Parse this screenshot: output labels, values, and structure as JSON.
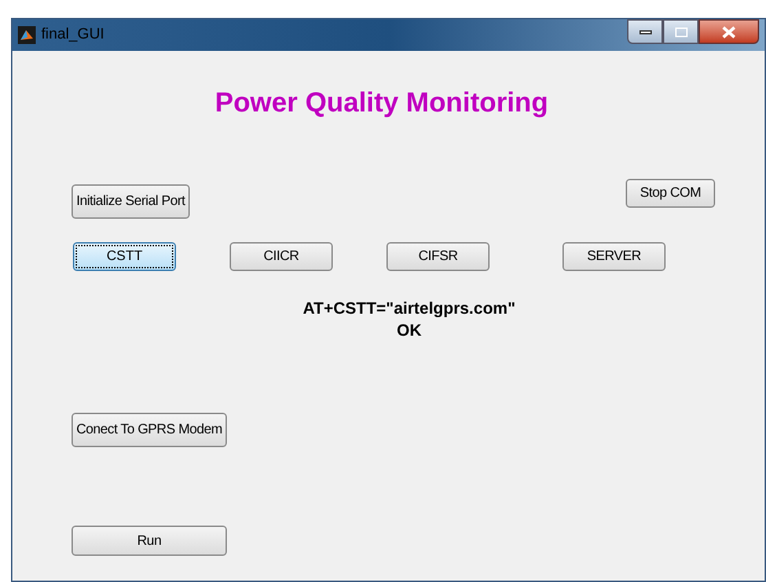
{
  "window": {
    "title": "final_GUI"
  },
  "heading": "Power Quality Monitoring",
  "init_button": "Initialize Serial Port",
  "stop_button": "Stop COM",
  "command_buttons": [
    {
      "label": "CSTT",
      "selected": true
    },
    {
      "label": "CIICR",
      "selected": false
    },
    {
      "label": "CIFSR",
      "selected": false
    },
    {
      "label": "SERVER",
      "selected": false
    }
  ],
  "response": [
    "AT+CSTT=\"airtelgprs.com\"",
    "OK"
  ],
  "connect_button": "Conect To GPRS Modem",
  "run_button": "Run"
}
